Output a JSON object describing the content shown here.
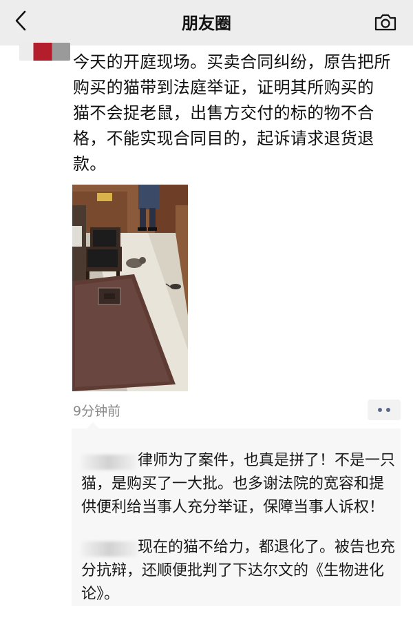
{
  "navbar": {
    "title": "朋友圈",
    "back_icon": "chevron-left-icon",
    "camera_icon": "camera-icon"
  },
  "post": {
    "lines": [
      "今天的开庭现场。买卖合同纠纷，原告把所",
      "购买的猫带到法庭举证，证明其所购买的",
      "猫不会捉老鼠，出售方交付的标的物不合",
      "格，不能实现合同目的，起诉请求退货退",
      "款。"
    ],
    "timestamp": "9分钟前",
    "more_icon": "more-dots-icon"
  },
  "comments": [
    {
      "lines": [
        "律师为了案件，也真是拼了！不是一只",
        "猫，是购买了一大批。也多谢法院的宽容和提",
        "供便利给当事人充分举证，保障当事人诉权！"
      ]
    },
    {
      "lines": [
        "现在的猫不给力，都退化了。被告也充",
        "分抗辩，还顺便批判了下达尔文的《生物进化",
        "论》。"
      ]
    }
  ],
  "colors": {
    "navbar_bg": "#ededed",
    "comment_bg": "#f7f7f7",
    "timestamp": "#8a8a8a",
    "link_blue": "#5b6a8a"
  }
}
